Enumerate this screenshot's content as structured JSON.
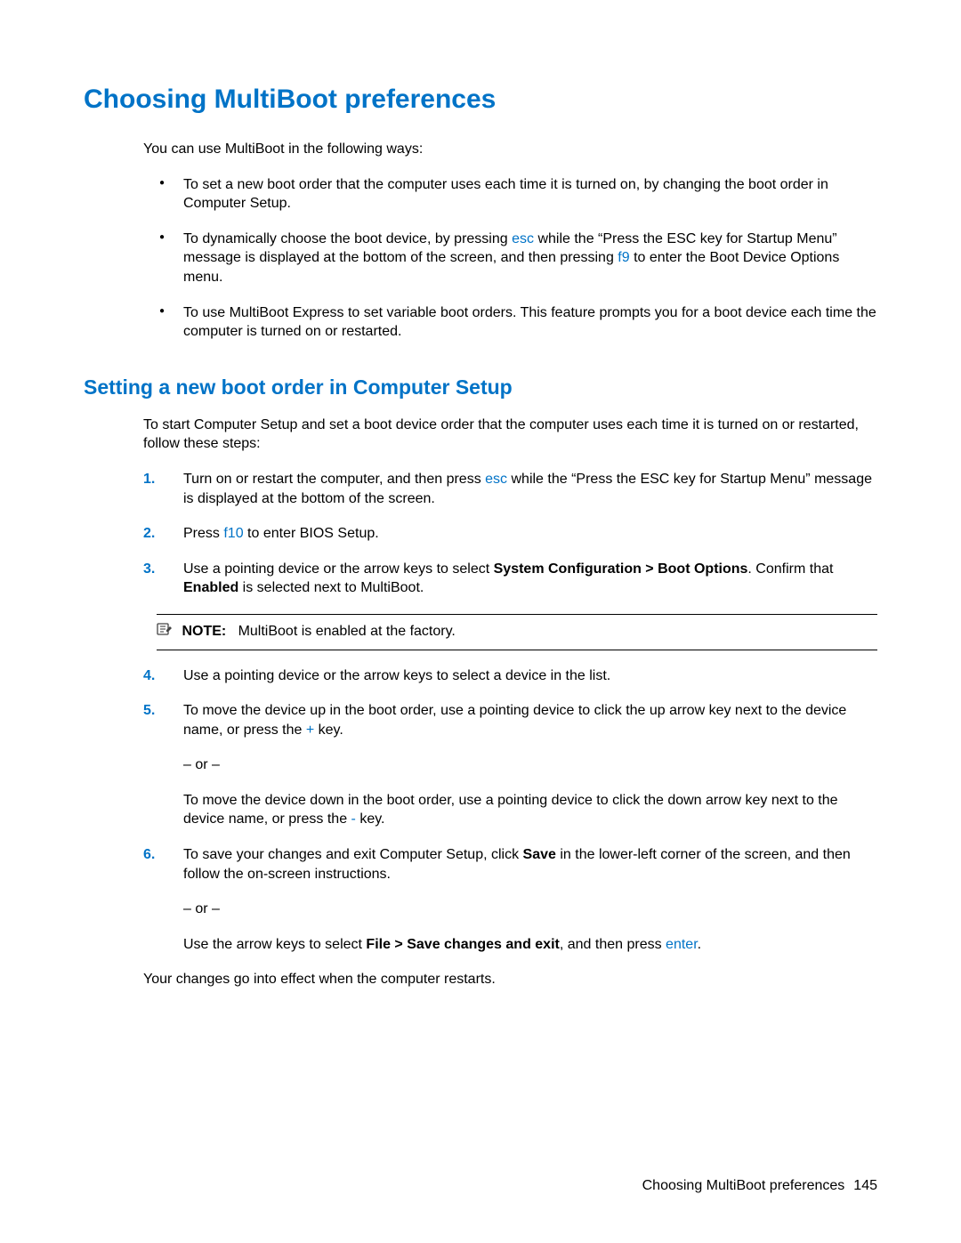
{
  "heading": "Choosing MultiBoot preferences",
  "intro": "You can use MultiBoot in the following ways:",
  "bullets": [
    {
      "pre": "To set a new boot order that the computer uses each time it is turned on, by changing the boot order in Computer Setup."
    },
    {
      "pre": "To dynamically choose the boot device, by pressing ",
      "kw1": "esc",
      "mid": " while the “Press the ESC key for Startup Menu” message is displayed at the bottom of the screen, and then pressing ",
      "kw2": "f9",
      "post": " to enter the Boot Device Options menu."
    },
    {
      "pre": "To use MultiBoot Express to set variable boot orders. This feature prompts you for a boot device each time the computer is turned on or restarted."
    }
  ],
  "subheading": "Setting a new boot order in Computer Setup",
  "sub_intro": "To start Computer Setup and set a boot device order that the computer uses each time it is turned on or restarted, follow these steps:",
  "steps": {
    "s1": {
      "num": "1.",
      "pre": "Turn on or restart the computer, and then press ",
      "kw": "esc",
      "post": " while the “Press the ESC key for Startup Menu” message is displayed at the bottom of the screen."
    },
    "s2": {
      "num": "2.",
      "pre": "Press ",
      "kw": "f10",
      "post": " to enter BIOS Setup."
    },
    "s3": {
      "num": "3.",
      "pre": "Use a pointing device or the arrow keys to select ",
      "bold1": "System Configuration > Boot Options",
      "mid": ". Confirm that ",
      "bold2": "Enabled",
      "post": " is selected next to MultiBoot."
    },
    "s4": {
      "num": "4.",
      "text": "Use a pointing device or the arrow keys to select a device in the list."
    },
    "s5": {
      "num": "5.",
      "pre": "To move the device up in the boot order, use a pointing device to click the up arrow key next to the device name, or press the ",
      "kw1": "+",
      "post1": " key.",
      "or": "– or –",
      "pre2": "To move the device down in the boot order, use a pointing device to click the down arrow key next to the device name, or press the ",
      "kw2": "-",
      "post2": " key."
    },
    "s6": {
      "num": "6.",
      "pre": "To save your changes and exit Computer Setup, click ",
      "bold1": "Save",
      "post1": " in the lower-left corner of the screen, and then follow the on-screen instructions.",
      "or": "– or –",
      "pre2": "Use the arrow keys to select ",
      "bold2": "File > Save changes and exit",
      "mid2": ", and then press ",
      "kw2": "enter",
      "post2": "."
    }
  },
  "note": {
    "label": "NOTE:",
    "text": "MultiBoot is enabled at the factory."
  },
  "closing": "Your changes go into effect when the computer restarts.",
  "footer_text": "Choosing MultiBoot preferences",
  "footer_page": "145"
}
